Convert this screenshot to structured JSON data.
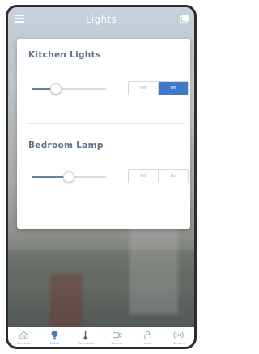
{
  "header": {
    "title": "Lights",
    "menu_icon": "menu-icon",
    "copy_icon": "copy-icon"
  },
  "devices": [
    {
      "name": "Kitchen Lights",
      "brightness": 0.33,
      "off_label": "Off",
      "on_label": "On",
      "state": "on"
    },
    {
      "name": "Bedroom Lamp",
      "brightness": 0.5,
      "off_label": "Off",
      "on_label": "On",
      "state": "off"
    }
  ],
  "tabs": [
    {
      "label": "Overview",
      "icon": "home-icon"
    },
    {
      "label": "Lights",
      "icon": "bulb-icon",
      "active": true
    },
    {
      "label": "Thermostat",
      "icon": "thermometer-icon"
    },
    {
      "label": "Camera",
      "icon": "camera-icon"
    },
    {
      "label": "Locks",
      "icon": "lock-icon"
    },
    {
      "label": "Sensors",
      "icon": "sensor-icon"
    }
  ],
  "colors": {
    "accent": "#3f78c8",
    "heading": "#5c7088",
    "tab_active": "#4a7bc0"
  }
}
